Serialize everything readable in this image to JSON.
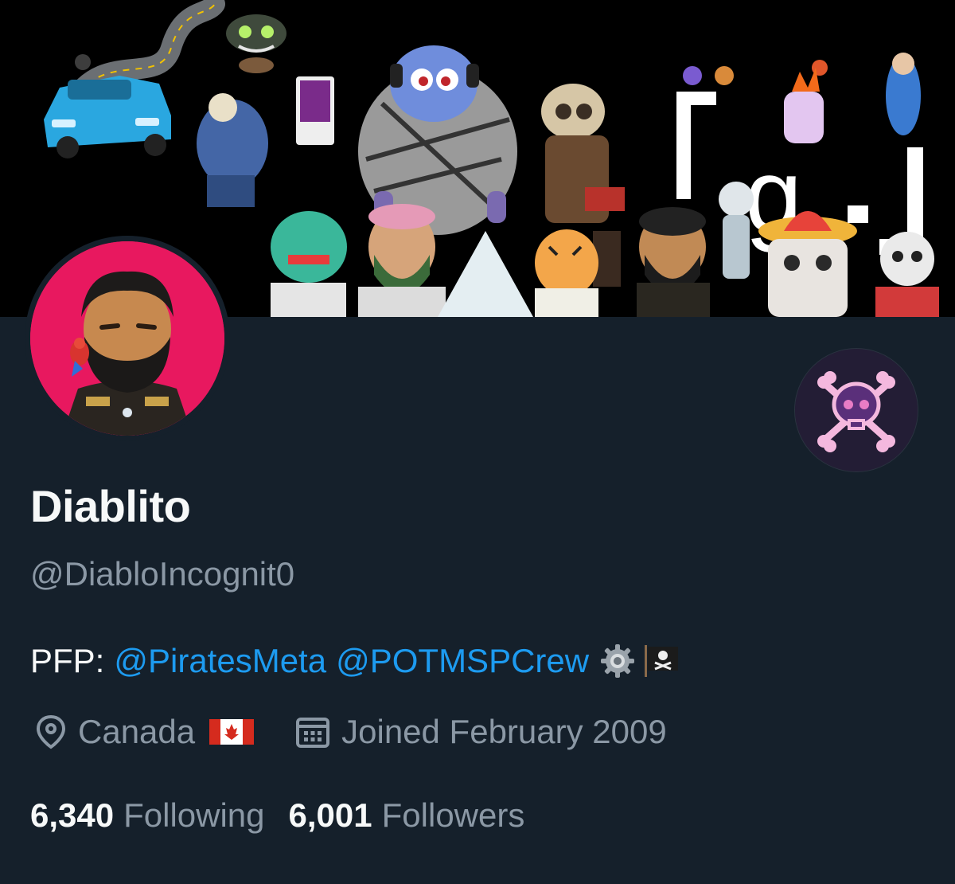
{
  "profile": {
    "display_name": "Diablito",
    "handle": "@DiabloIncognit0",
    "bio": {
      "prefix": "PFP:",
      "mentions": [
        "@PiratesMeta",
        "@POTMSPCrew"
      ],
      "emoji_icons": [
        "gear-icon",
        "pirate-flag-icon"
      ]
    },
    "location": "Canada",
    "location_flag_icon": "canada-flag-icon",
    "joined": "Joined February 2009",
    "following_count": "6,340",
    "following_label": "Following",
    "followers_count": "6,001",
    "followers_label": "Followers"
  },
  "banner": {
    "logo_text": "g"
  },
  "colors": {
    "background": "#15202b",
    "primary_text": "#f7f9f9",
    "secondary_text": "#8b98a5",
    "link": "#1d9bf0",
    "avatar_bg": "#e8185f"
  }
}
